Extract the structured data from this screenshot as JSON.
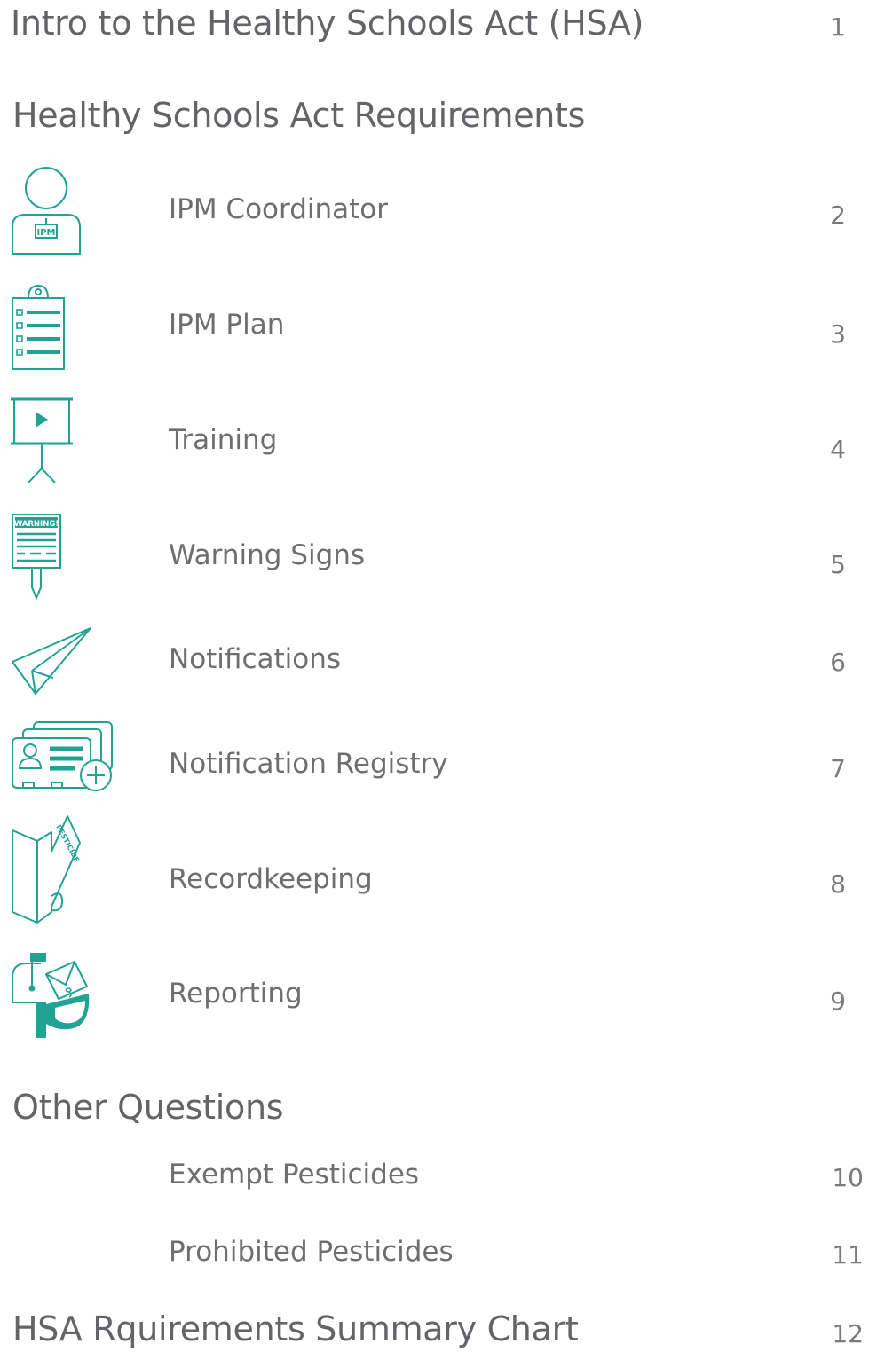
{
  "colors": {
    "accent": "#21a293",
    "text": "#6e6e70",
    "heading": "#646468"
  },
  "sections": {
    "intro": {
      "title": "Intro to the Healthy Schools Act (HSA)",
      "page": "1"
    },
    "requirements": {
      "title": "Healthy Schools Act Requirements"
    },
    "other": {
      "title": "Other Questions"
    },
    "summary": {
      "title": "HSA Rquirements Summary Chart",
      "page": "12"
    }
  },
  "requirements": [
    {
      "label": "IPM Coordinator",
      "page": "2",
      "icon": "ipm-coordinator-icon",
      "badge": "IPM"
    },
    {
      "label": "IPM Plan",
      "page": "3",
      "icon": "clipboard-checklist-icon"
    },
    {
      "label": "Training",
      "page": "4",
      "icon": "projector-screen-icon"
    },
    {
      "label": "Warning Signs",
      "page": "5",
      "icon": "warning-sign-icon",
      "badge": "WARNING!"
    },
    {
      "label": "Notifications",
      "page": "6",
      "icon": "paper-plane-icon"
    },
    {
      "label": "Notification Registry",
      "page": "7",
      "icon": "id-cards-add-icon"
    },
    {
      "label": "Recordkeeping",
      "page": "8",
      "icon": "folder-pesticide-icon",
      "badge": "PESTICIDE"
    },
    {
      "label": "Reporting",
      "page": "9",
      "icon": "mailbox-icon"
    }
  ],
  "other_questions": [
    {
      "label": "Exempt Pesticides",
      "page": "10"
    },
    {
      "label": "Prohibited Pesticides",
      "page": "11"
    }
  ]
}
